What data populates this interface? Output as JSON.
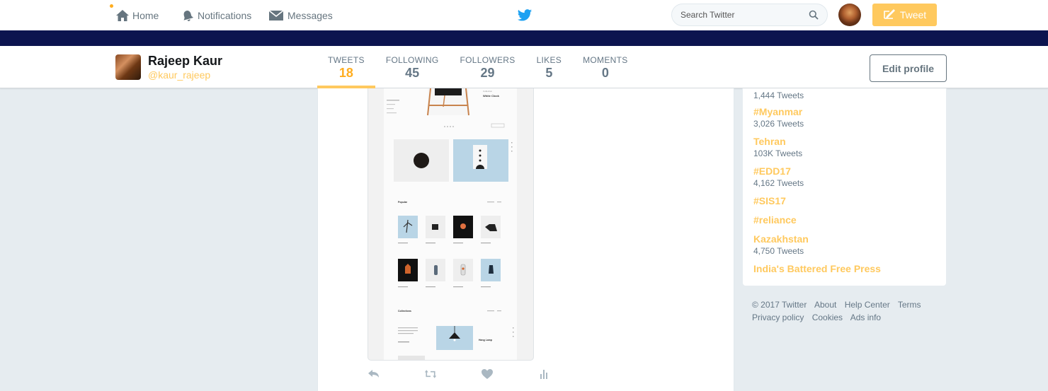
{
  "topnav": {
    "home": "Home",
    "notifications": "Notifications",
    "messages": "Messages",
    "search_placeholder": "Search Twitter",
    "tweet_button": "Tweet"
  },
  "colors": {
    "accent": "#ffc95e",
    "accent_dark": "#ffad1f",
    "band": "#0c144f",
    "twitter_blue": "#1da1f2"
  },
  "profile": {
    "name": "Rajeep Kaur",
    "handle": "@kaur_rajeep",
    "edit_button": "Edit profile",
    "stats": [
      {
        "label": "TWEETS",
        "value": "18",
        "active": true
      },
      {
        "label": "FOLLOWING",
        "value": "45"
      },
      {
        "label": "FOLLOWERS",
        "value": "29"
      },
      {
        "label": "LIKES",
        "value": "5"
      },
      {
        "label": "MOMENTS",
        "value": "0"
      }
    ]
  },
  "media_shot": {
    "labels": {
      "white_clock": "White Clock",
      "popular": "Popular",
      "collections": "Collections",
      "hang_lamp": "Hang Lamp"
    }
  },
  "tweet_actions": [
    "reply-icon",
    "retweet-icon",
    "like-icon",
    "analytics-icon"
  ],
  "trends": [
    {
      "count": "1,444 Tweets"
    },
    {
      "title": "#Myanmar",
      "count": "3,026 Tweets"
    },
    {
      "title": "Tehran",
      "count": "103K Tweets"
    },
    {
      "title": "#EDD17",
      "count": "4,162 Tweets"
    },
    {
      "title": "#SIS17"
    },
    {
      "title": "#reliance"
    },
    {
      "title": "Kazakhstan",
      "count": "4,750 Tweets"
    },
    {
      "title": "India's Battered Free Press"
    }
  ],
  "footer": [
    "© 2017 Twitter",
    "About",
    "Help Center",
    "Terms",
    "Privacy policy",
    "Cookies",
    "Ads info"
  ]
}
